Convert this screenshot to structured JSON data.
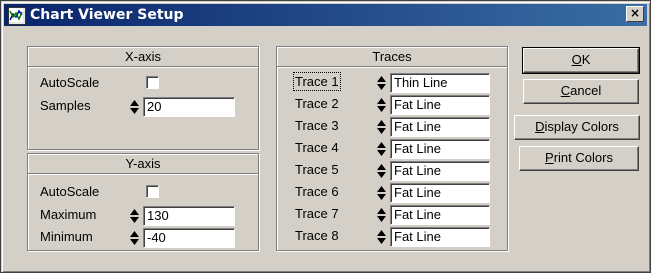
{
  "window": {
    "title": "Chart Viewer Setup",
    "close_glyph": "×"
  },
  "xaxis": {
    "header": "X-axis",
    "autoscale_label": "AutoScale",
    "autoscale_checked": false,
    "samples_label": "Samples",
    "samples_value": "20"
  },
  "yaxis": {
    "header": "Y-axis",
    "autoscale_label": "AutoScale",
    "autoscale_checked": false,
    "maximum_label": "Maximum",
    "maximum_value": "130",
    "minimum_label": "Minimum",
    "minimum_value": "-40"
  },
  "traces": {
    "header": "Traces",
    "items": [
      {
        "label": "Trace 1",
        "value": "Thin Line"
      },
      {
        "label": "Trace 2",
        "value": "Fat Line"
      },
      {
        "label": "Trace 3",
        "value": "Fat Line"
      },
      {
        "label": "Trace 4",
        "value": "Fat Line"
      },
      {
        "label": "Trace 5",
        "value": "Fat Line"
      },
      {
        "label": "Trace 6",
        "value": "Fat Line"
      },
      {
        "label": "Trace 7",
        "value": "Fat Line"
      },
      {
        "label": "Trace 8",
        "value": "Fat Line"
      }
    ]
  },
  "buttons": {
    "ok": {
      "mnemonic": "O",
      "rest": "K"
    },
    "cancel": {
      "mnemonic": "C",
      "rest": "ancel"
    },
    "display_colors": {
      "mnemonic": "D",
      "rest": "isplay Colors"
    },
    "print_colors": {
      "mnemonic": "P",
      "rest": "rint Colors"
    }
  },
  "colors": {
    "titlebar_start": "#0a246a",
    "titlebar_end": "#3a6ea5",
    "face": "#d4d0c8"
  },
  "icons": {
    "title": "chart-icon",
    "close": "close-icon",
    "spin": "spinner-icon"
  }
}
